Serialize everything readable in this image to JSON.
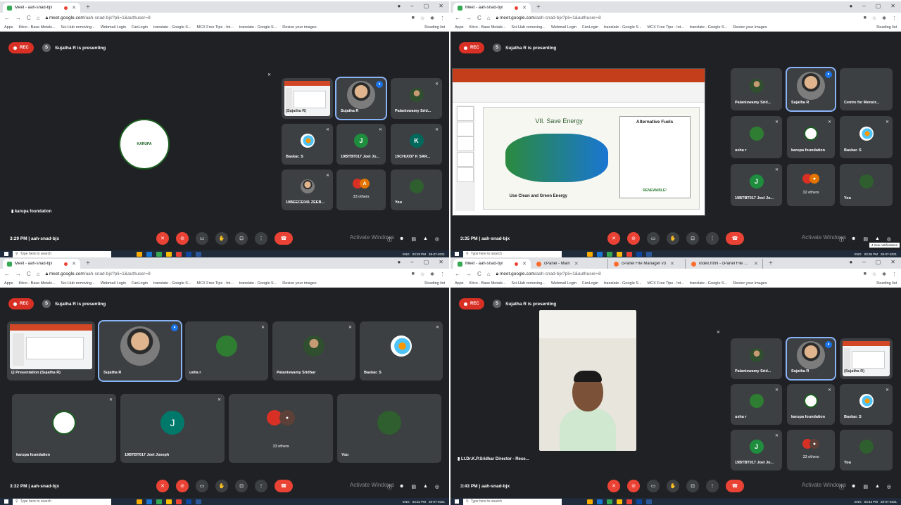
{
  "browser": {
    "tab_title": "Meet - aah-snad-bjx",
    "url_host": "meet.google.com",
    "url_path": "/aah-snad-bjx?pli=1&authuser=8",
    "bookmarks": [
      "Apps",
      "Kitco - Base Metals...",
      "Sci-Hub removing...",
      "Webmail Login",
      "FanLogin",
      "translate - Google S...",
      "MCX Free Tips - Int...",
      "translate - Google S...",
      "Resize your images"
    ],
    "reading_list": "Reading list",
    "q4_tabs": [
      "Meet - aah-snad-bjx",
      "cPanel - Main",
      "cPanel File Manager v3",
      "index.html - cPanel File Manager"
    ]
  },
  "meet": {
    "rec_label": "REC",
    "presenting_label": "Sujatha R is presenting",
    "meeting_code": "aah-snad-bjx",
    "activate_title": "Activate Windows",
    "activate_sub": "Go to Settings to activate Windows.",
    "q1": {
      "time": "3:29 PM",
      "pinned_label": "karupa foundation",
      "tiles": [
        "(Sujatha R)",
        "Sujatha R",
        "Palaniswamy Srid...",
        "Baskar. S",
        "19BTBT017 Joel Jo...",
        "19CHU037 K SAR...",
        "19BEECE041 ZEEB...",
        "33 others",
        "You"
      ],
      "initial_j": "J",
      "initial_k": "K"
    },
    "q2": {
      "time": "3:35 PM",
      "tiles": [
        "Palaniswamy Srid...",
        "Sujatha R",
        "Centre for Menstr...",
        "usha r",
        "karupa foundation",
        "Baskar. S",
        "19BTBT017 Joel Jo...",
        "32 others",
        "You"
      ],
      "initial_j": "J",
      "slide_title": "VII. Save Energy",
      "slide_sub": "Use Clean and Green Energy",
      "slide_box_title": "Alternative Fuels",
      "slide_box_foot": "RENEWABLE!",
      "notification": "4 new notifications"
    },
    "q3": {
      "time": "3:32 PM",
      "tiles": [
        "Presentation (Sujatha R)",
        "Sujatha R",
        "usha r",
        "Palaniswamy Sridhar",
        "Baskar. S",
        "karupa foundation",
        "19BTBT017 Joel Joseph",
        "33 others",
        "You"
      ],
      "initial_j": "J"
    },
    "q4": {
      "time": "3:43 PM",
      "pinned_label": "Lt.Dr.K.P.Sridhar Director - Rese...",
      "tiles": [
        "Palaniswamy Srid...",
        "Sujatha R",
        "(Sujatha R)",
        "usha r",
        "karupa foundation",
        "Baskar. S",
        "19BTBT017 Joel Jo...",
        "33 others",
        "You"
      ],
      "initial_j": "J"
    }
  },
  "taskbar": {
    "search_placeholder": "Type here to search",
    "lang": "ENG",
    "times": [
      "03:29 PM",
      "03:35 PM",
      "03:32 PM",
      "03:43 PM"
    ],
    "date": "28-07-2021"
  },
  "colors": {
    "rec": "#d93025",
    "meet_bg": "#202124",
    "tile_bg": "#3c4043",
    "end_call": "#ea4335",
    "accent": "#1a73e8"
  },
  "icons": [
    "mic-off-icon",
    "camera-off-icon",
    "captions-icon",
    "raise-hand-icon",
    "present-icon",
    "more-icon",
    "end-call-icon",
    "info-icon",
    "people-icon",
    "chat-icon",
    "activities-icon",
    "lock-icon"
  ]
}
